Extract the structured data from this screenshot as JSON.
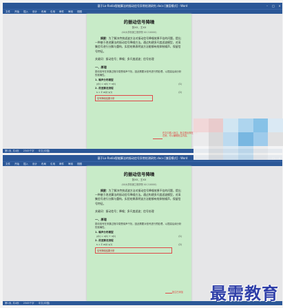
{
  "windows": [
    {
      "title": "基于Lo-Radia智能算法的振动信号异常检测研究.docx [兼容模式] - Word",
      "ribbon": [
        "文件",
        "开始",
        "插入",
        "设计",
        "布局",
        "引用",
        "邮件",
        "审阅",
        "视图"
      ],
      "status": [
        "第1页, 共4页",
        "2345个字",
        "中文(中国)"
      ],
      "paper": {
        "title": "的振动信号降噪",
        "authors": "张XX，王XX",
        "affil": "(XX大学机械工程学院 XX 210000)",
        "abstract_label": "摘要：",
        "abstract": "为了解决传统滤波方法对振动信号降噪效果不佳的问题，提出一种基于改进算法的振动信号降噪方法。通过构建多尺度滤波模型，对采集信号进行分解与重构，实验结果表明该方法能够有效抑制噪声，保留信号特征。",
        "keywords": "关键词：振动信号；降噪；多尺度滤波；信号处理",
        "section1": "一、原理",
        "body1": "振动信号在采集过程中易受噪声干扰，因此需要对信号进行预处理，以提高后续分析的准确性。",
        "sub1": "1. 噪声分布模型",
        "eq1": "y(t) = x(t) + n(t)",
        "eq1_no": "(1)",
        "sub2": "2. 改进算法流程",
        "eq2": "s = Σ w(i)·y(i)",
        "eq2_no": "(2)",
        "highlight": "信号降噪结果分析",
        "callout": "在文中插入批注，批注框出现在页面右侧，可以编辑批注内容。"
      }
    },
    {
      "title": "基于Lo-Radia智能算法的振动信号异常检测研究.docx [兼容模式] - Word",
      "ribbon": [
        "文件",
        "开始",
        "插入",
        "设计",
        "布局",
        "引用",
        "邮件",
        "审阅",
        "视图"
      ],
      "status": [
        "第1页, 共4页",
        "2345个字",
        "中文(中国)"
      ],
      "paper": {
        "title": "的振动信号降噪",
        "authors": "张XX，王XX",
        "affil": "(XX大学机械工程学院 XX 210000)",
        "abstract_label": "摘要：",
        "abstract": "为了解决传统滤波方法对振动信号降噪效果不佳的问题，提出一种基于改进算法的振动信号降噪方法。通过构建多尺度滤波模型，对采集信号进行分解与重构，实验结果表明该方法能够有效抑制噪声，保留信号特征。",
        "keywords": "关键词：振动信号；降噪；多尺度滤波；信号处理",
        "section1": "一、原理",
        "body1": "振动信号在采集过程中易受噪声干扰，因此需要对信号进行预处理，以提高后续分析的准确性。",
        "sub1": "1. 噪声分布模型",
        "eq1": "y(t) = x(t) + n(t)",
        "eq1_no": "(1)",
        "sub2": "2. 改进算法流程",
        "eq2": "s = Σ w(i)·y(i)",
        "eq2_no": "(2)",
        "highlight": "信号降噪结果分析",
        "callout": "批注已添加"
      }
    }
  ],
  "watermark": "最需教育",
  "colors": {
    "page_bg": "#c8ebc8",
    "titlebar": "#2b5797",
    "annotation": "#e04848",
    "watermark": "#2f3fa8"
  },
  "mosaic_colors": [
    "#f2d6d6",
    "#e9c9c9",
    "#cfe6f2",
    "#a9d4ee",
    "#7fbfe6",
    "#d9e9f4",
    "#ececec",
    "#d8d8d8",
    "#b8d9ef",
    "#6fb3e0",
    "#98c9ea",
    "#e0e0e0",
    "#f6f6f6",
    "#e4e4e4",
    "#dbe9f3",
    "#c7dff0",
    "#eeeeee",
    "#f5f5f5"
  ]
}
